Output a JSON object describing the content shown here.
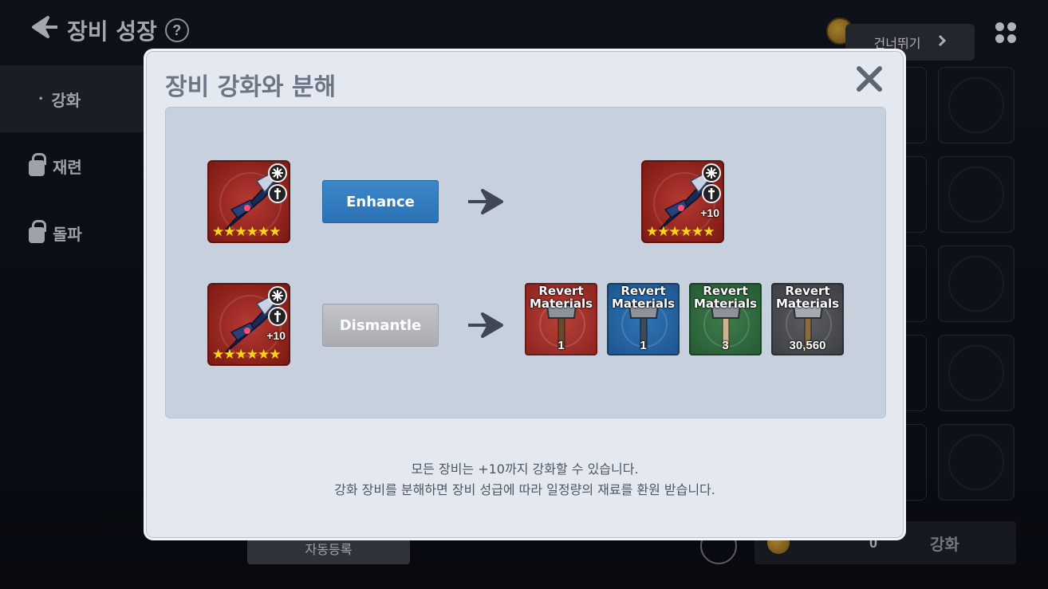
{
  "background": {
    "title": "장비 성장",
    "help_icon": "?",
    "skip_label": "건너뛰기",
    "sidebar": [
      {
        "label": "강화",
        "locked": false,
        "active": true
      },
      {
        "label": "재련",
        "locked": true,
        "active": false
      },
      {
        "label": "돌파",
        "locked": true,
        "active": false
      }
    ],
    "bottom_left_label": "자동등록",
    "gold_count": "0",
    "enhance_label": "강화"
  },
  "modal": {
    "title": "장비 강화와 분해",
    "close_icon": "close-icon",
    "enhance_row": {
      "button_label": "Enhance",
      "result_plus": "+10"
    },
    "dismantle_row": {
      "source_plus": "+10",
      "button_label": "Dismantle",
      "materials": [
        {
          "name_line1": "Revert",
          "name_line2": "Materials",
          "qty": "1",
          "color": "#a8302a"
        },
        {
          "name_line1": "Revert",
          "name_line2": "Materials",
          "qty": "1",
          "color": "#1f5f9e"
        },
        {
          "name_line1": "Revert",
          "name_line2": "Materials",
          "qty": "3",
          "color": "#2f6a3e"
        },
        {
          "name_line1": "Revert",
          "name_line2": "Materials",
          "qty": "30,560",
          "color": "#4a4c50"
        }
      ]
    },
    "stars": "★★★★★★",
    "description_line1": "모든 장비는 +10까지 강화할 수 있습니다.",
    "description_line2": "강화 장비를 분해하면 장비 성급에 따라 일정량의 재료를 환원 받습니다."
  },
  "colors": {
    "modal_bg": "#e4e9f1",
    "panel_bg": "#c7d1dd",
    "enhance_button": "#3380c0",
    "dismantle_button": "#b5b8bd",
    "item_red": "#9b2a24"
  }
}
